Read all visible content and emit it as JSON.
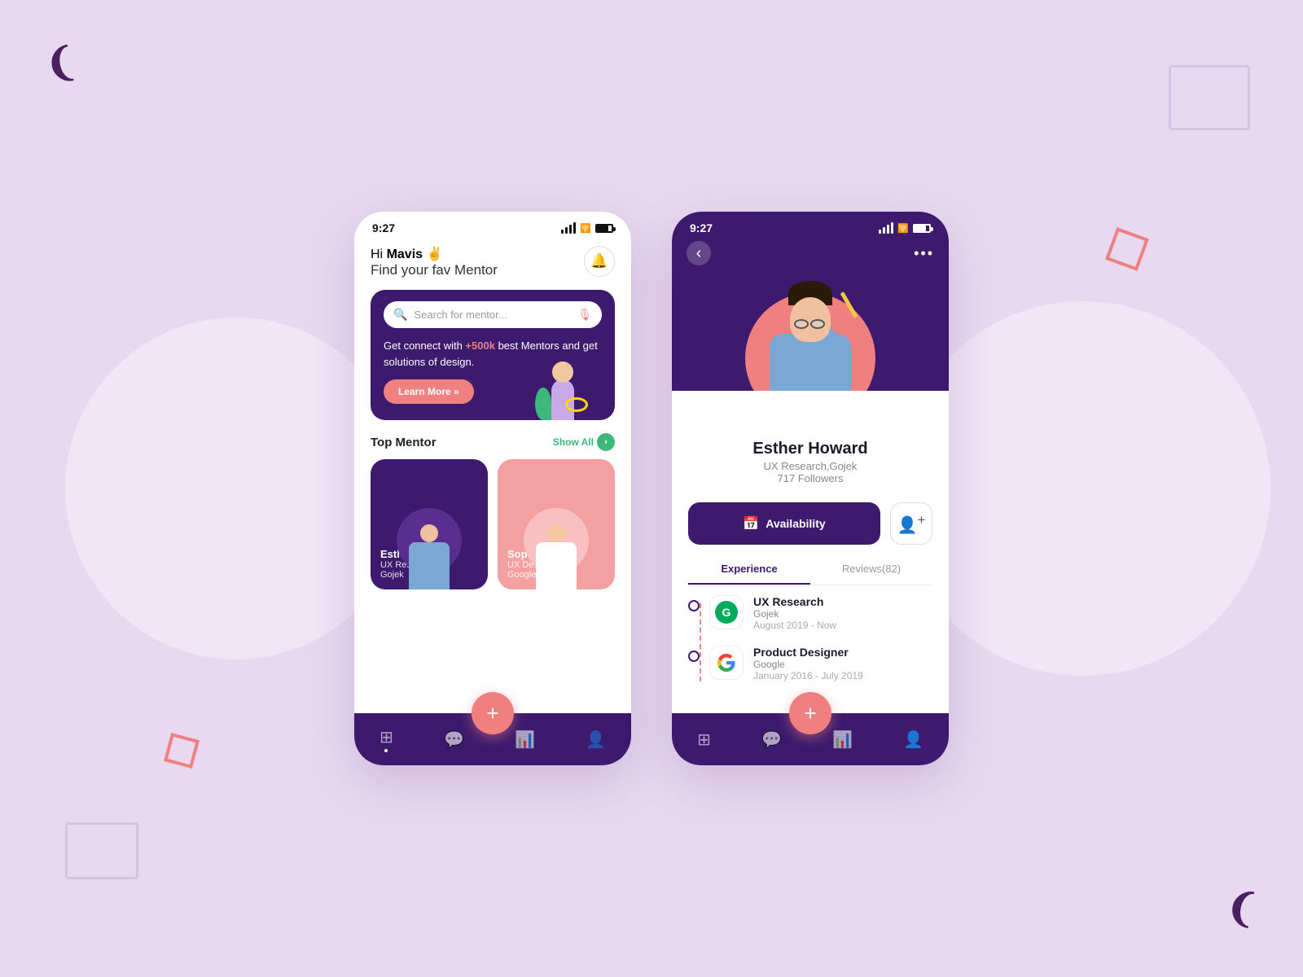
{
  "background_color": "#e8d9f0",
  "phone1": {
    "status": {
      "time": "9:27"
    },
    "header": {
      "greeting_prefix": "Hi ",
      "greeting_name": "Mavis",
      "greeting_emoji": "✌",
      "subtitle": "Find your fav Mentor"
    },
    "notification_icon": "🔔",
    "search_banner": {
      "placeholder": "Search for mentor...",
      "body_text_prefix": "Get connect with ",
      "body_text_highlight": "+500k",
      "body_text_suffix": " best Mentors and get solutions of design.",
      "cta_label": "Learn More »"
    },
    "top_mentor": {
      "section_title": "Top Mentor",
      "show_all_label": "Show All",
      "mentors": [
        {
          "name": "Esther Howard",
          "role": "UX Research,",
          "company": "Gojek",
          "bg_color": "#3d1a6e"
        },
        {
          "name": "Sophia Wilson",
          "role": "UX Designer,",
          "company": "Google",
          "bg_color": "#f4a0a0"
        }
      ]
    },
    "bottom_nav": {
      "items": [
        "⊞",
        "💬",
        "📊",
        "👤"
      ],
      "fab_label": "+"
    }
  },
  "phone2": {
    "status": {
      "time": "9:27"
    },
    "topbar": {
      "back_label": "‹",
      "more_label": "•••"
    },
    "profile": {
      "name": "Esther Howard",
      "subtitle": "UX Research,Gojek",
      "followers": "717 Followers"
    },
    "actions": {
      "availability_label": "Availability",
      "add_user_icon": "👤+"
    },
    "tabs": [
      {
        "label": "Experience",
        "active": true
      },
      {
        "label": "Reviews(82)",
        "active": false
      }
    ],
    "experience": [
      {
        "role": "UX Research",
        "company": "Gojek",
        "period": "August 2019 - Now",
        "logo_type": "gojek"
      },
      {
        "role": "Product Designer",
        "company": "Google",
        "period": "January 2016 - July 2019",
        "logo_type": "google"
      }
    ],
    "bottom_nav": {
      "items": [
        "⊞",
        "💬",
        "📊",
        "👤"
      ],
      "fab_label": "+"
    }
  }
}
